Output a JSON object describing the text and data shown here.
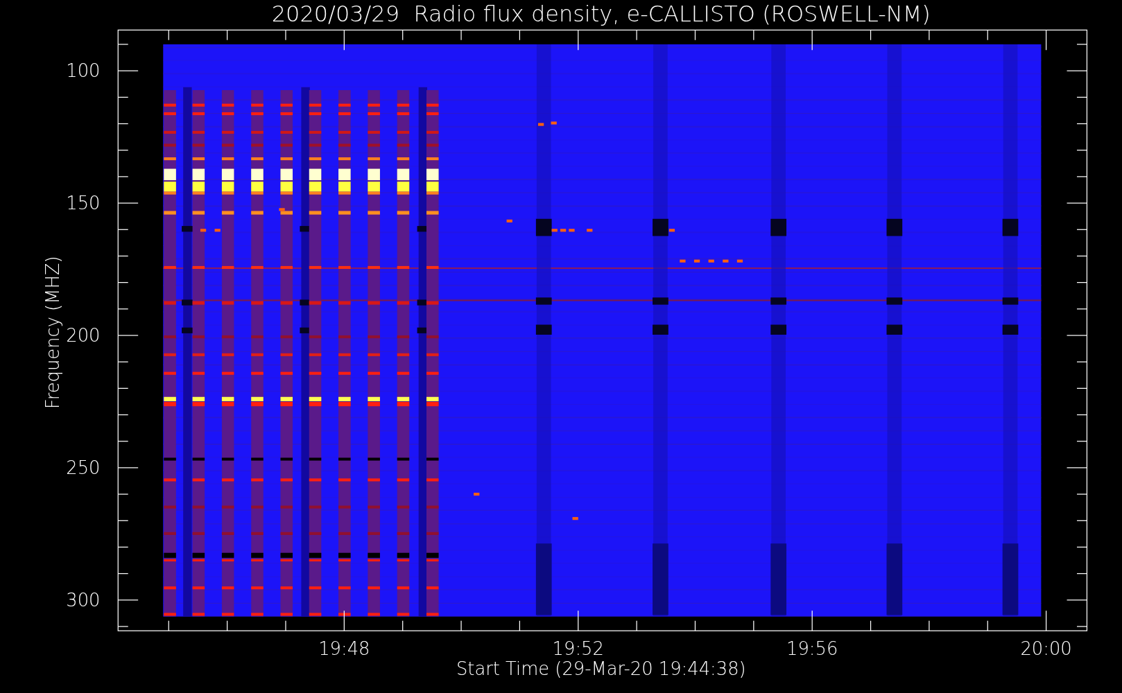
{
  "title": "2020/03/29  Radio flux density, e-CALLISTO (ROSWELL-NM)",
  "y_axis": {
    "label": "Frequency (MHZ)",
    "tick_labels": [
      "100",
      "150",
      "200",
      "250",
      "300"
    ]
  },
  "x_axis": {
    "label": "Start Time (29-Mar-20 19:44:38)",
    "tick_labels": [
      "19:48",
      "19:52",
      "19:56",
      "20:00"
    ]
  }
}
